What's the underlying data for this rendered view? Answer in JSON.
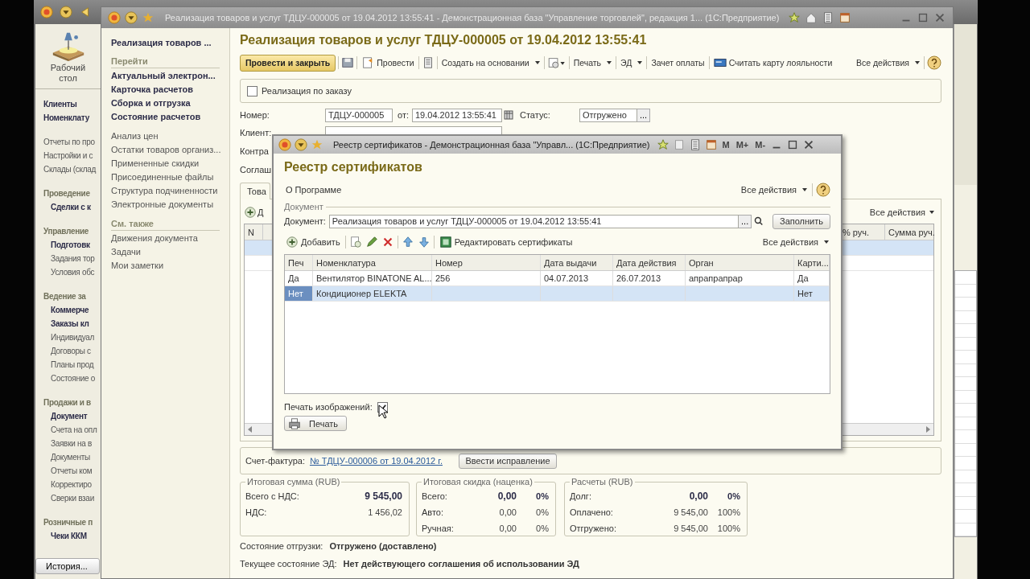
{
  "main_window": {
    "desktop_label": "Рабочий стол",
    "sections": [
      {
        "items": [
          {
            "label": "Клиенты",
            "bold": true
          },
          {
            "label": "Номенклату",
            "bold": true
          }
        ]
      },
      {
        "items": [
          {
            "label": "Отчеты по про",
            "bold": false
          },
          {
            "label": "Настройки и с",
            "bold": false
          },
          {
            "label": "Склады (склад",
            "bold": false
          }
        ]
      },
      {
        "title": "Проведение",
        "items": [
          {
            "label": "Сделки с к",
            "bold": true
          }
        ]
      },
      {
        "title": "Управление",
        "items": [
          {
            "label": "Подготовк",
            "bold": true
          },
          {
            "label": "Задания тор",
            "bold": false
          },
          {
            "label": "Условия обс",
            "bold": false
          }
        ]
      },
      {
        "title": "Ведение за",
        "items": [
          {
            "label": "Коммерче",
            "bold": true
          },
          {
            "label": "Заказы кл",
            "bold": true
          },
          {
            "label": "Индивидуал",
            "bold": false
          },
          {
            "label": "Договоры с",
            "bold": false
          },
          {
            "label": "Планы прод",
            "bold": false
          },
          {
            "label": "Состояние о",
            "bold": false
          }
        ]
      },
      {
        "title": "Продажи и в",
        "items": [
          {
            "label": "Документ",
            "bold": true
          },
          {
            "label": "Счета на опл",
            "bold": false
          },
          {
            "label": "Заявки на в",
            "bold": false
          },
          {
            "label": "Документы",
            "bold": false
          },
          {
            "label": "Отчеты ком",
            "bold": false
          },
          {
            "label": "Корректиро",
            "bold": false
          },
          {
            "label": "Сверки взаи",
            "bold": false
          }
        ]
      },
      {
        "title": "Розничные п",
        "items": [
          {
            "label": "Чеки ККМ",
            "bold": true
          }
        ]
      }
    ],
    "history_button": "История..."
  },
  "document_window": {
    "title": "Реализация товаров и услуг ТДЦУ-000005 от 19.04.2012 13:55:41 - Демонстрационная база \"Управление торговлей\", редакция 1... (1С:Предприятие)",
    "nav": {
      "current": "Реализация товаров ...",
      "groups": [
        {
          "title": "Перейти",
          "items": [
            {
              "label": "Актуальный электрон...",
              "bold": true
            },
            {
              "label": "Карточка расчетов",
              "bold": true
            },
            {
              "label": "Сборка и отгрузка",
              "bold": true
            },
            {
              "label": "Состояние расчетов",
              "bold": true
            }
          ]
        },
        {
          "items": [
            {
              "label": "Анализ цен",
              "bold": false
            },
            {
              "label": "Остатки товаров организ...",
              "bold": false
            },
            {
              "label": "Примененные скидки",
              "bold": false
            },
            {
              "label": "Присоединенные файлы",
              "bold": false
            },
            {
              "label": "Структура подчиненности",
              "bold": false
            },
            {
              "label": "Электронные документы",
              "bold": false
            }
          ]
        },
        {
          "title": "См. также",
          "items": [
            {
              "label": "Движения документа",
              "bold": false
            },
            {
              "label": "Задачи",
              "bold": false
            },
            {
              "label": "Мои заметки",
              "bold": false
            }
          ]
        }
      ]
    },
    "heading": "Реализация товаров и услуг ТДЦУ-000005 от 19.04.2012 13:55:41",
    "primary_button": "Провести и закрыть",
    "toolbar": [
      {
        "kind": "save"
      },
      {
        "kind": "post",
        "label": "Провести"
      },
      {
        "kind": "list"
      },
      {
        "kind": "menu",
        "label": "Создать на основании"
      },
      {
        "kind": "icon-menu"
      },
      {
        "kind": "menu",
        "label": "Печать"
      },
      {
        "kind": "menu",
        "label": "ЭД"
      },
      {
        "kind": "text",
        "label": "Зачет оплаты"
      },
      {
        "kind": "card",
        "label": "Считать карту лояльности"
      }
    ],
    "all_actions": "Все действия",
    "order_checkbox": {
      "label": "Реализация по заказу",
      "checked": false
    },
    "number_label": "Номер:",
    "number": "ТДЦУ-000005",
    "date_label": "от:",
    "date": "19.04.2012 13:55:41",
    "status_label": "Статус:",
    "status": "Отгружено",
    "status_button": "...",
    "client_label": "Клиент:",
    "contract_label": "Контра",
    "agreement_label": "Соглаш",
    "tab_label": "Това",
    "tab_add": "Д",
    "tab_all_actions": "Все действия",
    "columns": [
      "N",
      "% руч.",
      "Сумма руч."
    ],
    "invoice_label": "Счет-фактура:",
    "invoice_link": "№ ТДЦУ-000006 от 19.04.2012 г.",
    "correction_button": "Ввести исправление",
    "totals": [
      {
        "title": "Итоговая сумма (RUB)",
        "rows": [
          {
            "label": "Всего с НДС:",
            "value": "9 545,00",
            "bold": true
          },
          {
            "label": "НДС:",
            "value": "1 456,02",
            "bold": false
          }
        ]
      },
      {
        "title": "Итоговая скидка (наценка)",
        "rows": [
          {
            "label": "Всего:",
            "value": "0,00",
            "percent": "0%",
            "bold": true
          },
          {
            "label": "Авто:",
            "value": "0,00",
            "percent": "0%",
            "bold": false
          },
          {
            "label": "Ручная:",
            "value": "0,00",
            "percent": "0%",
            "bold": false
          }
        ]
      },
      {
        "title": "Расчеты (RUB)",
        "rows": [
          {
            "label": "Долг:",
            "value": "0,00",
            "percent": "0%",
            "bold": true
          },
          {
            "label": "Оплачено:",
            "value": "9 545,00",
            "percent": "100%",
            "bold": false
          },
          {
            "label": "Отгружено:",
            "value": "9 545,00",
            "percent": "100%",
            "bold": false
          }
        ]
      }
    ],
    "shipment_label": "Состояние отгрузки:",
    "shipment": "Отгружено (доставлено)",
    "ed_label": "Текущее состояние ЭД:",
    "ed": "Нет действующего соглашения об использовании ЭД"
  },
  "dialog": {
    "title": "Реестр сертификатов - Демонстрационная база \"Управл... (1С:Предприятие)",
    "calc_keys": [
      "M",
      "M+",
      "M-"
    ],
    "heading": "Реестр сертификатов",
    "about_button": "О Программе",
    "all_actions": "Все действия",
    "group_title": "Документ",
    "document_label": "Документ:",
    "document_value": "Реализация товаров и услуг ТДЦУ-000005 от 19.04.2012 13:55:41",
    "document_button": "...",
    "fill_button": "Заполнить",
    "add_button": "Добавить",
    "edit_button": "Редактировать сертификаты",
    "table_all_actions": "Все действия",
    "columns": [
      "Печ",
      "Номенклатура",
      "Номер",
      "Дата выдачи",
      "Дата действия",
      "Орган",
      "Карти..."
    ],
    "rows": [
      {
        "cells": [
          "Да",
          "Вентилятор BINATONE AL...",
          "256",
          "04.07.2013",
          "26.07.2013",
          "апрапрапрар",
          "Да"
        ],
        "selected": false
      },
      {
        "cells": [
          "Нет",
          "Кондиционер ELEKTA",
          "",
          "",
          "",
          "",
          "Нет"
        ],
        "selected": true
      }
    ],
    "print_images_label": "Печать изображений:",
    "print_images": true,
    "print_button": "Печать"
  }
}
